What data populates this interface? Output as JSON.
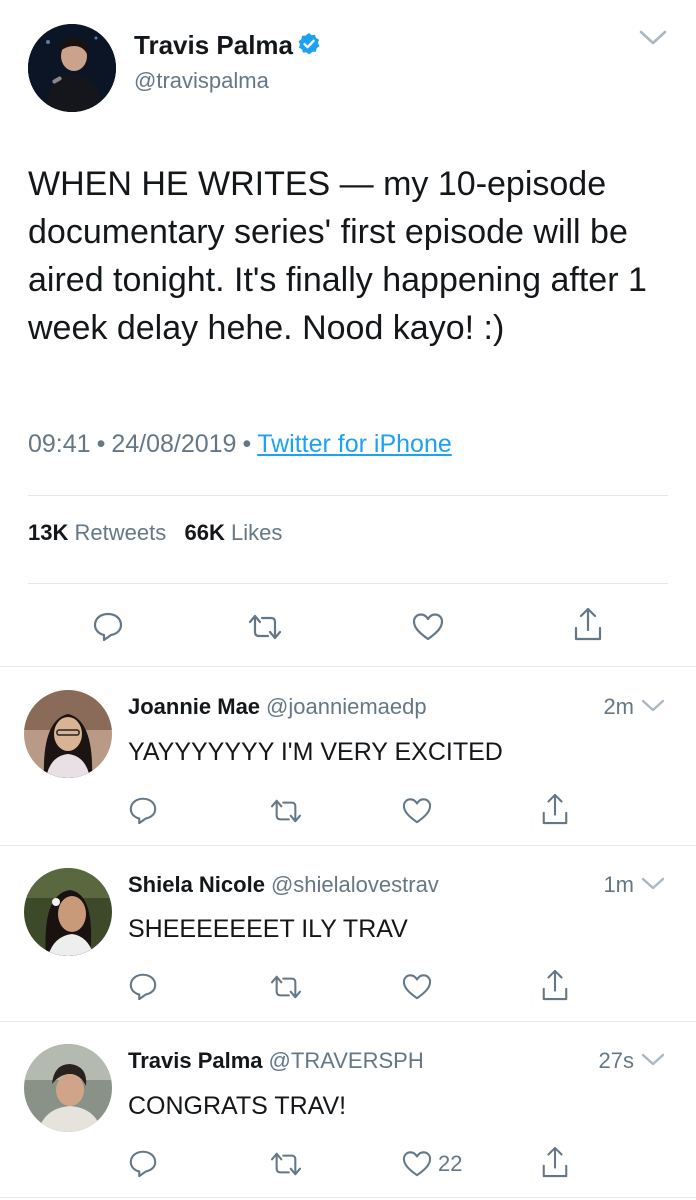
{
  "tweet": {
    "author_name": "Travis Palma",
    "author_handle": "@travispalma",
    "verified": true,
    "text": "WHEN HE WRITES — my 10-episode documentary series' first episode will be aired tonight. It's finally happening after 1 week delay hehe. Nood kayo! :)",
    "time": "09:41",
    "date": "24/08/2019",
    "source": "Twitter for iPhone",
    "retweets_count": "13K",
    "retweets_label": "Retweets",
    "likes_count": "66K",
    "likes_label": "Likes"
  },
  "replies": [
    {
      "name": "Joannie Mae",
      "handle": "@joanniemaedp",
      "time": "2m",
      "text": "YAYYYYYYY I'M VERY EXCITED",
      "likes": ""
    },
    {
      "name": "Shiela Nicole",
      "handle": "@shielalovestrav",
      "time": "1m",
      "text": "SHEEEEEEET ILY TRAV",
      "likes": ""
    },
    {
      "name": "Travis Palma",
      "handle": "@TRAVERSPH",
      "time": "27s",
      "text": "CONGRATS TRAV!",
      "likes": "22"
    }
  ],
  "icons": {
    "reply": "reply-icon",
    "retweet": "retweet-icon",
    "like": "heart-icon",
    "share": "share-icon",
    "more": "chevron-down-icon",
    "verified": "verified-badge-icon"
  },
  "colors": {
    "link": "#1da1f2",
    "secondary_text": "#657786",
    "divider": "#e1e8ed"
  }
}
